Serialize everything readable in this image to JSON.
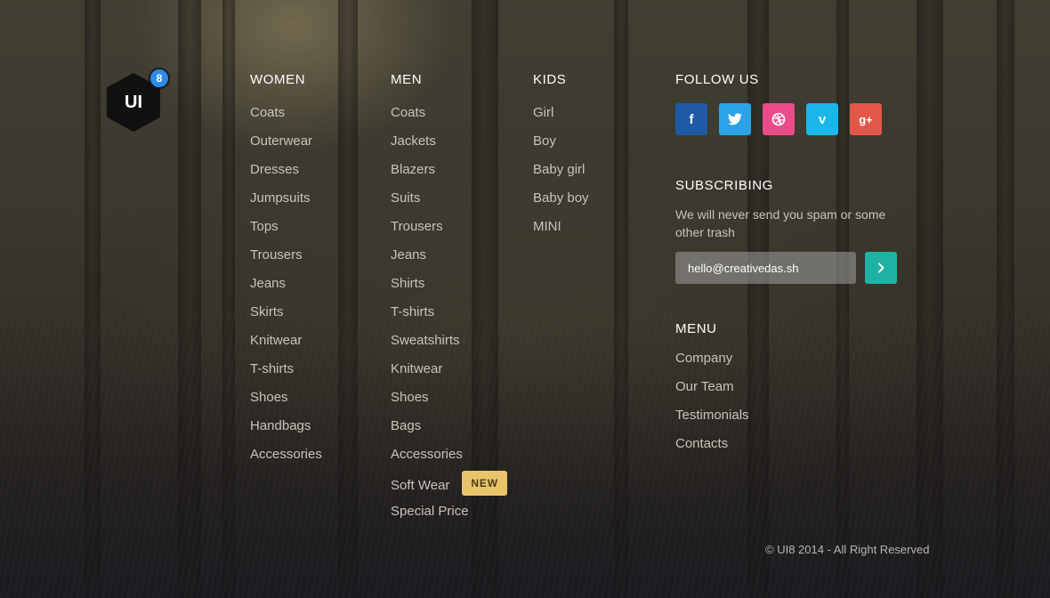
{
  "logo": {
    "text": "UI",
    "badge": "8"
  },
  "women": {
    "title": "WOMEN",
    "items": [
      "Coats",
      "Outerwear",
      "Dresses",
      "Jumpsuits",
      "Tops",
      "Trousers",
      "Jeans",
      "Skirts",
      "Knitwear",
      "T-shirts",
      "Shoes",
      "Handbags",
      "Accessories"
    ]
  },
  "men": {
    "title": "MEN",
    "items": [
      "Coats",
      "Jackets",
      "Blazers",
      "Suits",
      "Trousers",
      "Jeans",
      "Shirts",
      "T-shirts",
      "Sweatshirts",
      "Knitwear",
      "Shoes",
      "Bags",
      "Accessories",
      "Soft Wear",
      "Special Price"
    ],
    "new_badge": "NEW"
  },
  "kids": {
    "title": "KIDS",
    "items": [
      "Girl",
      "Boy",
      "Baby girl",
      "Baby boy",
      "MINI"
    ]
  },
  "follow": {
    "title": "FOLLOW US",
    "icons": [
      {
        "name": "facebook-icon",
        "glyph": "f"
      },
      {
        "name": "twitter-icon",
        "glyph": "t"
      },
      {
        "name": "dribbble-icon",
        "glyph": "◎"
      },
      {
        "name": "vimeo-icon",
        "glyph": "v"
      },
      {
        "name": "google-plus-icon",
        "glyph": "g+"
      }
    ]
  },
  "subscribe": {
    "title": "SUBSCRIBING",
    "text": "We will never send you spam or some other trash",
    "email_value": "hello@creativedas.sh",
    "submit_icon": "chevron-right-icon"
  },
  "menu": {
    "title": "MENU",
    "items": [
      "Company",
      "Our Team",
      "Testimonials",
      "Contacts"
    ]
  },
  "copyright": "© UI8 2014 - All Right Reserved",
  "colors": {
    "accent": "#1fb2a2",
    "badge_new": "#e9c46a",
    "logo_badge": "#2d8bea",
    "facebook": "#1f5aa6",
    "twitter": "#2aa3e6",
    "dribbble": "#ea4c89",
    "vimeo": "#1ab7ea",
    "google_plus": "#e3574a"
  }
}
